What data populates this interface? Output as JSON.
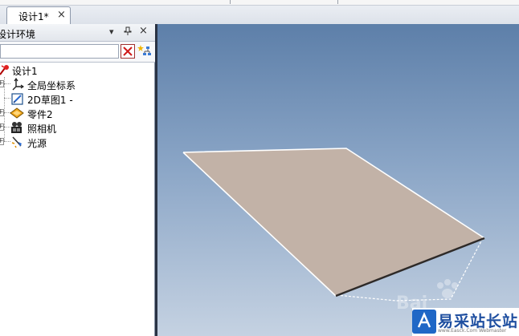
{
  "tabs": [
    {
      "label": "设计1*",
      "close": "×"
    }
  ],
  "panel": {
    "title": "设计环境",
    "pin_glyph": "ᵖ",
    "dropdown_glyph": "▾",
    "close_glyph": "×",
    "filter": {
      "value": "",
      "placeholder": ""
    }
  },
  "tree": {
    "root": {
      "label": "设计1",
      "icon": "design-root-icon"
    },
    "items": [
      {
        "label": "全局坐标系",
        "icon": "axis-icon",
        "expandable": true
      },
      {
        "label": "2D草图1 -",
        "icon": "sketch-icon",
        "expandable": false
      },
      {
        "label": "零件2",
        "icon": "part-icon",
        "expandable": true
      },
      {
        "label": "照相机",
        "icon": "camera-icon",
        "expandable": true
      },
      {
        "label": "光源",
        "icon": "light-icon",
        "expandable": true
      }
    ]
  },
  "viewport": {
    "plane_color": "#c2b2a7",
    "bg_top": "#5d7fa9",
    "bg_bottom": "#c5d2e2"
  },
  "watermark": {
    "text": "易采站长站",
    "sub": "www.Easck.Com Webmaster",
    "faint": "Bai"
  }
}
